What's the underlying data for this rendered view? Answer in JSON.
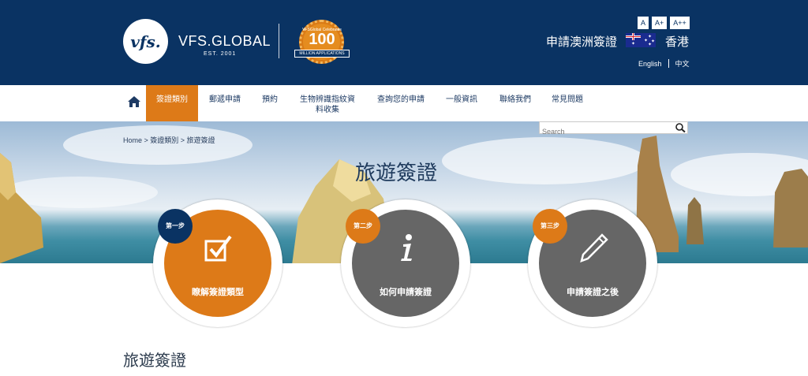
{
  "header": {
    "brand": {
      "logo_text": "vfs.",
      "name": "VFS.GLOBAL",
      "established": "EST. 2001"
    },
    "milestone_badge": {
      "top_text": "VFSGlobal Celebrates",
      "number": "100",
      "ribbon": "MILLION APPLICATIONS"
    },
    "font_sizes": [
      "A",
      "A+",
      "A++"
    ],
    "apply_title": "申請澳洲簽證",
    "country_flag": "australia-flag-icon",
    "location": "香港",
    "languages": [
      "English",
      "中文"
    ]
  },
  "nav": {
    "home_icon": "home-icon",
    "items": [
      {
        "label": "簽證類別",
        "active": true
      },
      {
        "label": "郵遞申請",
        "active": false
      },
      {
        "label": "預約",
        "active": false
      },
      {
        "label": "生物辨識指紋資料收集",
        "active": false
      },
      {
        "label": "查詢您的申請",
        "active": false
      },
      {
        "label": "一般資訊",
        "active": false
      },
      {
        "label": "聯絡我們",
        "active": false
      },
      {
        "label": "常見問題",
        "active": false
      }
    ]
  },
  "breadcrumb": {
    "text": "Home > 簽證類別 > 旅遊簽證"
  },
  "search": {
    "placeholder": "Search",
    "icon": "magnifier-icon"
  },
  "hero": {
    "title": "旅遊簽證"
  },
  "steps": [
    {
      "number": "第一步",
      "label": "瞭解簽證類型",
      "icon": "checkbox-icon",
      "color": "#dd7a18"
    },
    {
      "number": "第二步",
      "label": "如何申請簽證",
      "icon": "info-icon",
      "color": "#666666"
    },
    {
      "number": "第三步",
      "label": "申請簽證之後",
      "icon": "pencil-icon",
      "color": "#666666"
    }
  ],
  "section": {
    "title": "旅遊簽證"
  },
  "colors": {
    "header_bg": "#0a3363",
    "accent_orange": "#dd7a18",
    "step_gray": "#666666"
  }
}
